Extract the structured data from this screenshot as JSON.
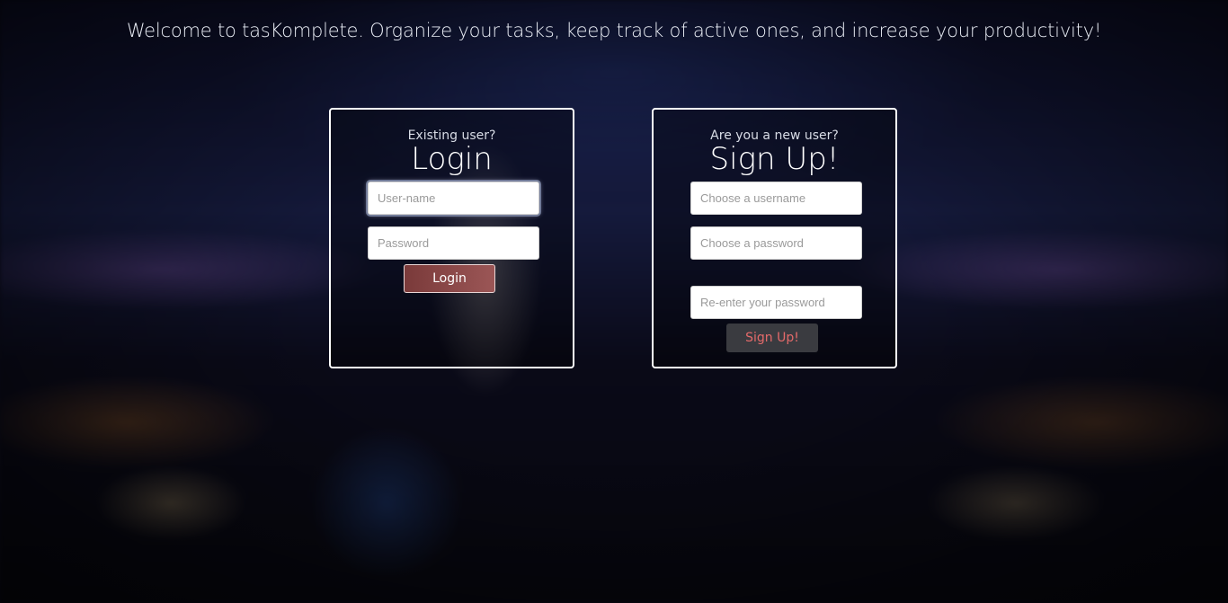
{
  "headline": "Welcome to tasKomplete. Organize your tasks, keep track of active ones, and increase your productivity!",
  "login": {
    "kicker": "Existing user?",
    "title": "Login",
    "username_placeholder": "User-name",
    "password_placeholder": "Password",
    "button_label": "Login"
  },
  "signup": {
    "kicker": "Are you a new user?",
    "title": "Sign Up!",
    "username_placeholder": "Choose a username",
    "password_placeholder": "Choose a password",
    "confirm_placeholder": "Re-enter your password",
    "button_label": "Sign Up!"
  },
  "colors": {
    "login_button": "#8a4848",
    "signup_button_text": "#e36a6a",
    "card_border": "#ffffff"
  }
}
